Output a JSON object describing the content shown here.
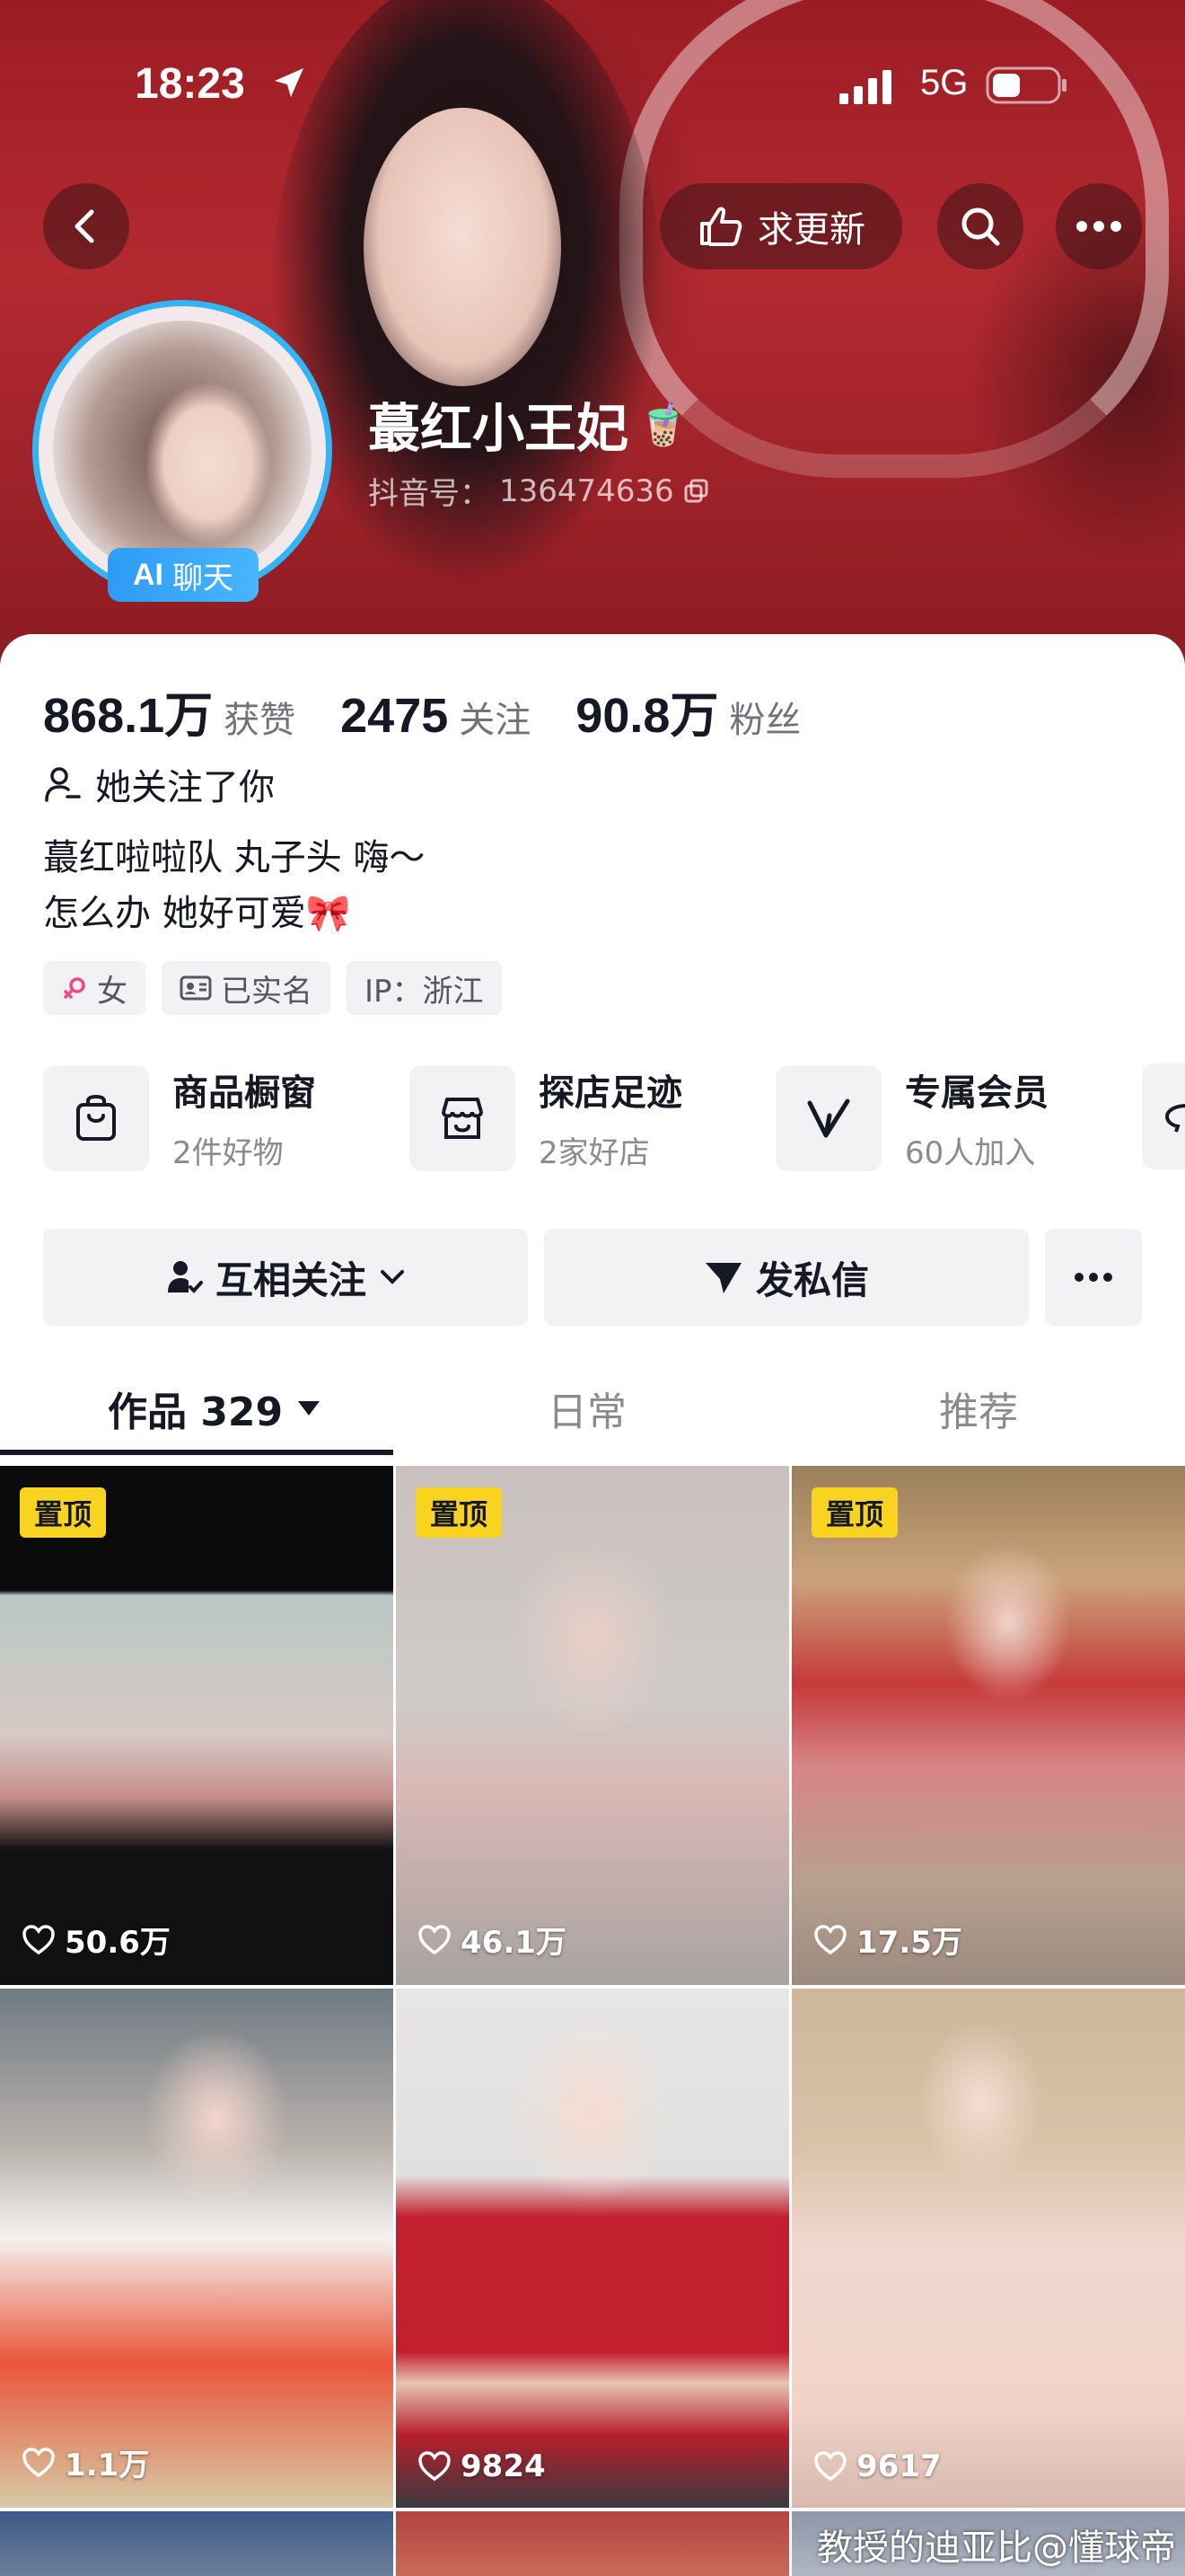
{
  "status_bar": {
    "time": "18:23",
    "network": "5G"
  },
  "top_bar": {
    "request_update_label": "求更新"
  },
  "profile": {
    "name": "蕞红小王妃",
    "name_emoji": "🧋",
    "douyin_id_label": "抖音号：",
    "douyin_id": "136474636",
    "ai_badge_prefix": "AI",
    "ai_badge_label": "聊天"
  },
  "stats": [
    {
      "value": "868.1万",
      "label": "获赞"
    },
    {
      "value": "2475",
      "label": "关注"
    },
    {
      "value": "90.8万",
      "label": "粉丝"
    }
  ],
  "follows_you": "她关注了你",
  "bio": {
    "line1": "蕞红啦啦队 丸子头 嗨～",
    "line2": "怎么办 她好可爱🎀"
  },
  "tags": {
    "gender": "女",
    "verified": "已实名",
    "ip": "IP：浙江"
  },
  "features": [
    {
      "title": "商品橱窗",
      "subtitle": "2件好物",
      "icon": "shopping-bag-icon"
    },
    {
      "title": "探店足迹",
      "subtitle": "2家好店",
      "icon": "store-icon"
    },
    {
      "title": "专属会员",
      "subtitle": "60人加入",
      "icon": "vip-v-icon"
    }
  ],
  "actions": {
    "mutual_follow": "互相关注",
    "message": "发私信"
  },
  "tabs": {
    "works": "作品 329",
    "daily": "日常",
    "recommend": "推荐"
  },
  "pinned_label": "置顶",
  "videos": [
    {
      "likes": "50.6万",
      "pinned": true
    },
    {
      "likes": "46.1万",
      "pinned": true
    },
    {
      "likes": "17.5万",
      "pinned": true
    },
    {
      "likes": "1.1万",
      "pinned": false
    },
    {
      "likes": "9824",
      "pinned": false
    },
    {
      "likes": "9617",
      "pinned": false
    }
  ],
  "watermark": "教授的迪亚比@懂球帝",
  "colors": {
    "avatar_ring": "#32b4f5",
    "pin_badge": "#f8d320",
    "cover_red": "#9c1c24"
  }
}
